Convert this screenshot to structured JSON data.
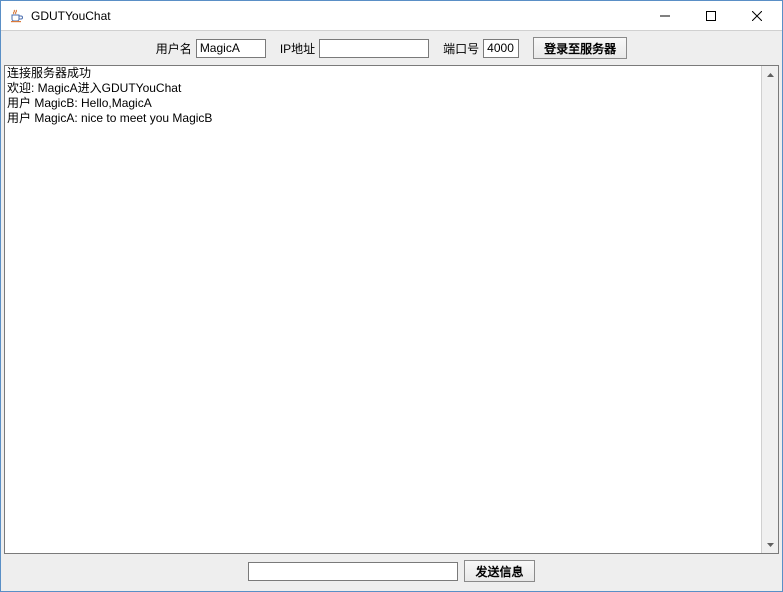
{
  "window": {
    "title": "GDUTYouChat"
  },
  "toolbar": {
    "username_label": "用户名",
    "username_value": "MagicA",
    "ip_label": "IP地址",
    "ip_value": "",
    "port_label": "端口号",
    "port_value": "4000",
    "login_button": "登录至服务器"
  },
  "chat": {
    "log": "连接服务器成功\n欢迎: MagicA进入GDUTYouChat\n用户 MagicB: Hello,MagicA\n用户 MagicA: nice to meet you MagicB"
  },
  "bottom": {
    "message_value": "",
    "send_button": "发送信息"
  }
}
